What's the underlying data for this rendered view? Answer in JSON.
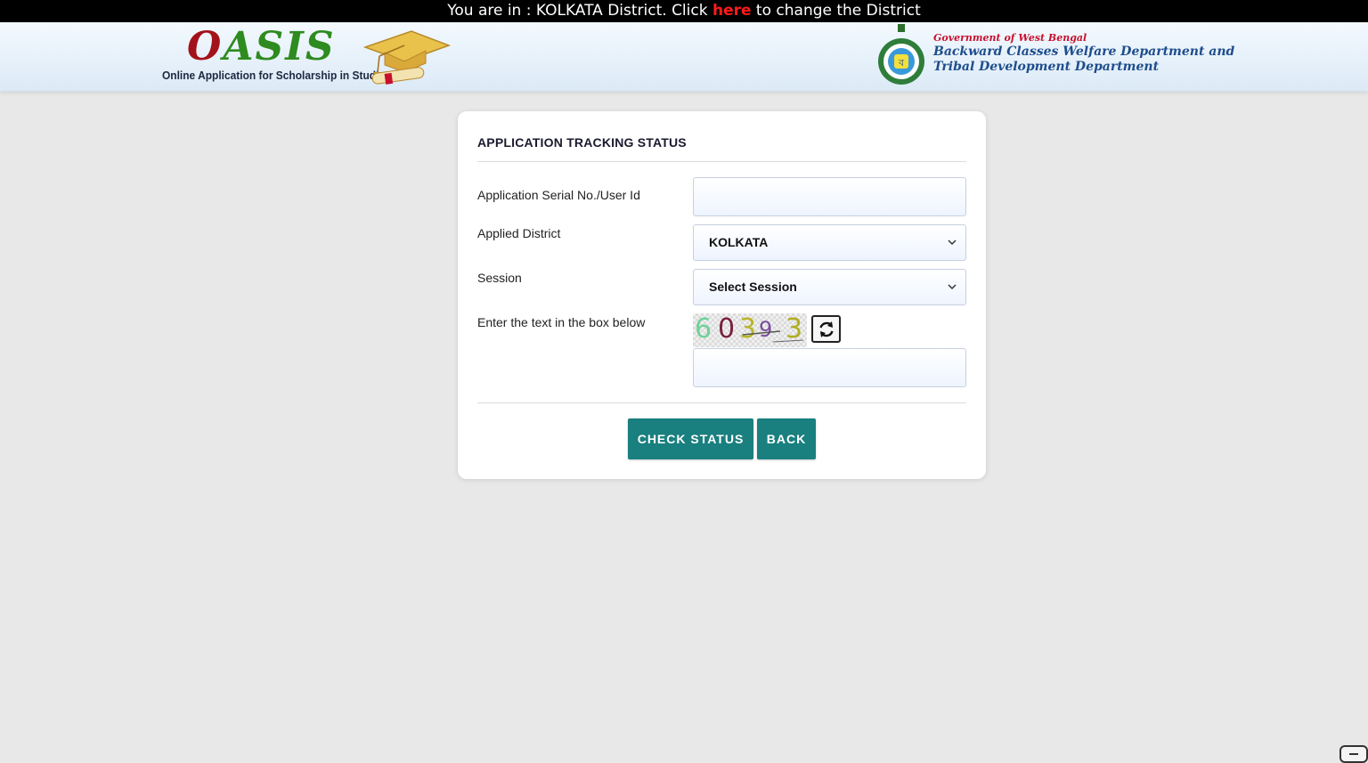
{
  "district_bar": {
    "prefix": "You are in : KOLKATA District. Click ",
    "link": "here",
    "suffix": " to change the District"
  },
  "header": {
    "logo_word_first": "O",
    "logo_word_rest": "ASIS",
    "logo_tagline": "Online Application for Scholarship in Studies",
    "gov_line1": "Government of West Bengal",
    "gov_line2": "Backward Classes Welfare Department and",
    "gov_line3": "Tribal Development Department"
  },
  "form": {
    "title": "APPLICATION TRACKING STATUS",
    "serial_label": "Application Serial No./User Id",
    "serial_value": "",
    "district_label": "Applied District",
    "district_selected": "KOLKATA",
    "session_label": "Session",
    "session_selected": "Select Session",
    "captcha_label": "Enter the text in the box below",
    "captcha_chars": [
      "6",
      "0",
      "3",
      "9",
      "3"
    ],
    "captcha_input_value": "",
    "check_status_label": "CHECK STATUS",
    "back_label": "BACK"
  },
  "colors": {
    "button": "#1a7f7f",
    "district_link": "#ff1a1a",
    "header_blue": "#1e4d8c",
    "gov_red": "#c8102e"
  }
}
